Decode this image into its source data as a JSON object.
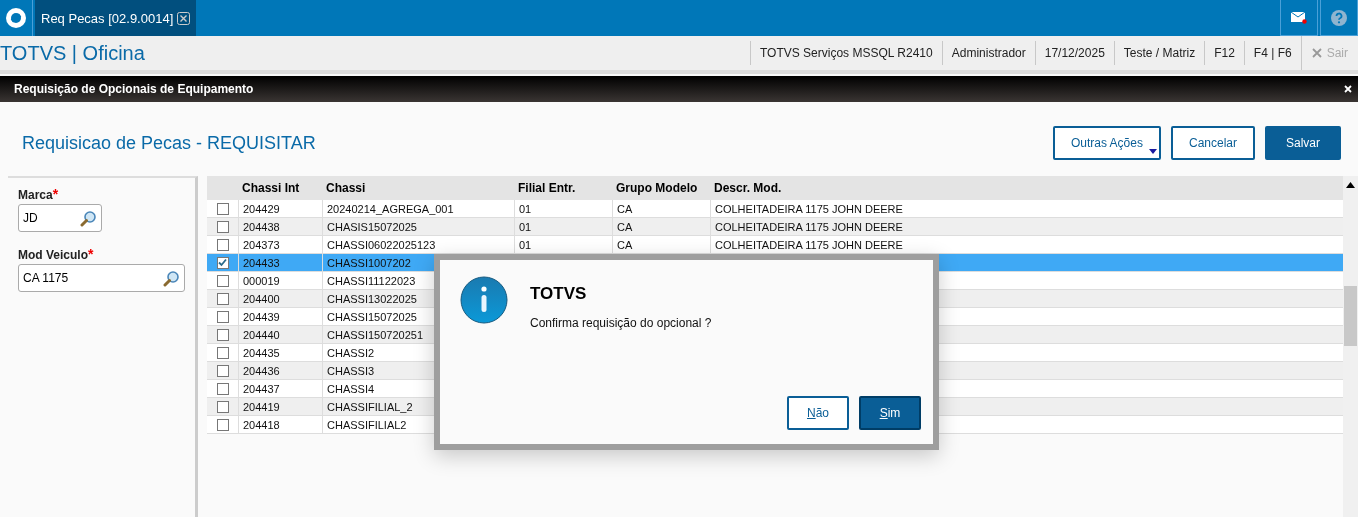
{
  "tabs": [
    {
      "label": "Req Pecas [02.9.0014]",
      "selected": true
    }
  ],
  "app_title": "TOTVS | Oficina",
  "status_items": [
    "TOTVS Serviços MSSQL R2410",
    "Administrador",
    "17/12/2025",
    "Teste / Matriz",
    "F12",
    "F4 | F6"
  ],
  "exit_label": "Sair",
  "window": {
    "title": "Requisição de Opcionais de Equipamento"
  },
  "page_title": "Requisicao de Pecas - REQUISITAR",
  "actions": [
    {
      "label": "Outras Ações",
      "kind": "menu"
    },
    {
      "label": "Cancelar",
      "kind": "outline"
    },
    {
      "label": "Salvar",
      "kind": "primary"
    }
  ],
  "fields": [
    {
      "label": "Marca",
      "required_mark": "*",
      "value": "JD"
    },
    {
      "label": "Mod Veiculo",
      "required_mark": "*",
      "value": "CA 1175"
    }
  ],
  "table": {
    "columns": [
      "Chassi Int",
      "Chassi",
      "Filial Entr.",
      "Grupo Modelo",
      "Descr. Mod."
    ],
    "rows": [
      {
        "checked": false,
        "selected": false,
        "cells": [
          "204429",
          "20240214_AGREGA_001",
          "01",
          "CA",
          "COLHEITADEIRA 1175 JOHN DEERE"
        ]
      },
      {
        "checked": false,
        "selected": false,
        "cells": [
          "204438",
          "CHASIS15072025",
          "01",
          "CA",
          "COLHEITADEIRA 1175 JOHN DEERE"
        ]
      },
      {
        "checked": false,
        "selected": false,
        "cells": [
          "204373",
          "CHASSI06022025123",
          "01",
          "CA",
          "COLHEITADEIRA 1175 JOHN DEERE"
        ]
      },
      {
        "checked": true,
        "selected": true,
        "cells": [
          "204433",
          "CHASSI1007202"
        ]
      },
      {
        "checked": false,
        "selected": false,
        "cells": [
          "000019",
          "CHASSI11122023"
        ]
      },
      {
        "checked": false,
        "selected": false,
        "cells": [
          "204400",
          "CHASSI13022025"
        ]
      },
      {
        "checked": false,
        "selected": false,
        "cells": [
          "204439",
          "CHASSI15072025"
        ]
      },
      {
        "checked": false,
        "selected": false,
        "cells": [
          "204440",
          "CHASSI150720251"
        ]
      },
      {
        "checked": false,
        "selected": false,
        "cells": [
          "204435",
          "CHASSI2"
        ]
      },
      {
        "checked": false,
        "selected": false,
        "cells": [
          "204436",
          "CHASSI3"
        ]
      },
      {
        "checked": false,
        "selected": false,
        "cells": [
          "204437",
          "CHASSI4"
        ]
      },
      {
        "checked": false,
        "selected": false,
        "cells": [
          "204419",
          "CHASSIFILIAL_2"
        ]
      },
      {
        "checked": false,
        "selected": false,
        "cells": [
          "204418",
          "CHASSIFILIAL2"
        ]
      }
    ]
  },
  "dialog": {
    "title": "TOTVS",
    "message": "Confirma requisição do opcional ?",
    "buttons": [
      {
        "label": "Não",
        "kind": "outline"
      },
      {
        "label": "Sim",
        "kind": "primary"
      }
    ]
  }
}
